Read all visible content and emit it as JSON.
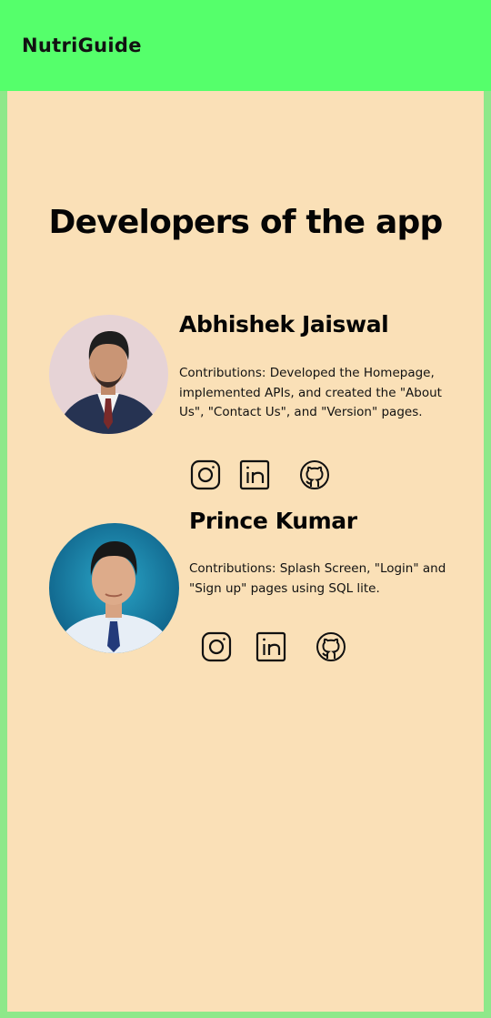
{
  "app_bar": {
    "title": "NutriGuide",
    "color": "#55ff6b"
  },
  "page": {
    "title": "Developers of the app",
    "background": "#fae0b7",
    "frame_color": "#8ee88a"
  },
  "developers": [
    {
      "name": "Abhishek Jaiswal",
      "contributions": "Contributions: Developed the Homepage, implemented APIs, and created the \"About Us\", \"Contact Us\", and \"Version\" pages.",
      "socials": [
        "instagram-icon",
        "linkedin-icon",
        "github-icon"
      ]
    },
    {
      "name": "Prince Kumar",
      "contributions": "Contributions: Splash Screen, \"Login\" and \"Sign up\" pages using SQL lite.",
      "socials": [
        "instagram-icon",
        "linkedin-icon",
        "github-icon"
      ]
    }
  ]
}
